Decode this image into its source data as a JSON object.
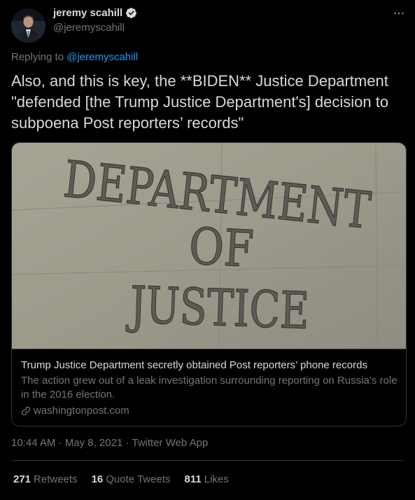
{
  "author": {
    "name": "jeremy scahill",
    "handle": "@jeremyscahill",
    "verified": true
  },
  "reply": {
    "prefix": "Replying to ",
    "mention": "@jeremyscahill"
  },
  "tweet_text": "Also, and this is key, the **BIDEN** Justice Department \"defended [the Trump Justice Department's] decision to subpoena Post reporters’ records\"",
  "card": {
    "image_lines": [
      "DEPARTMENT",
      "OF",
      "JUSTICE"
    ],
    "title": "Trump Justice Department secretly obtained Post reporters’ phone records",
    "description": "The action grew out of a leak investigation surrounding reporting on Russia’s role in the 2016 election.",
    "domain": "washingtonpost.com"
  },
  "meta": {
    "time": "10:44 AM",
    "sep1": " · ",
    "date": "May 8, 2021",
    "sep2": " · ",
    "source": "Twitter Web App"
  },
  "stats": [
    {
      "count": "271",
      "label": "Retweets"
    },
    {
      "count": "16",
      "label": "Quote Tweets"
    },
    {
      "count": "811",
      "label": "Likes"
    }
  ],
  "colors": {
    "background": "#000000",
    "text": "#d9d9d9",
    "secondary": "#6e767d",
    "accent": "#1d9bf0",
    "border": "#2f3336"
  },
  "icons": {
    "verified": "verified-badge-icon",
    "more": "more-dots-icon",
    "link": "link-icon"
  }
}
